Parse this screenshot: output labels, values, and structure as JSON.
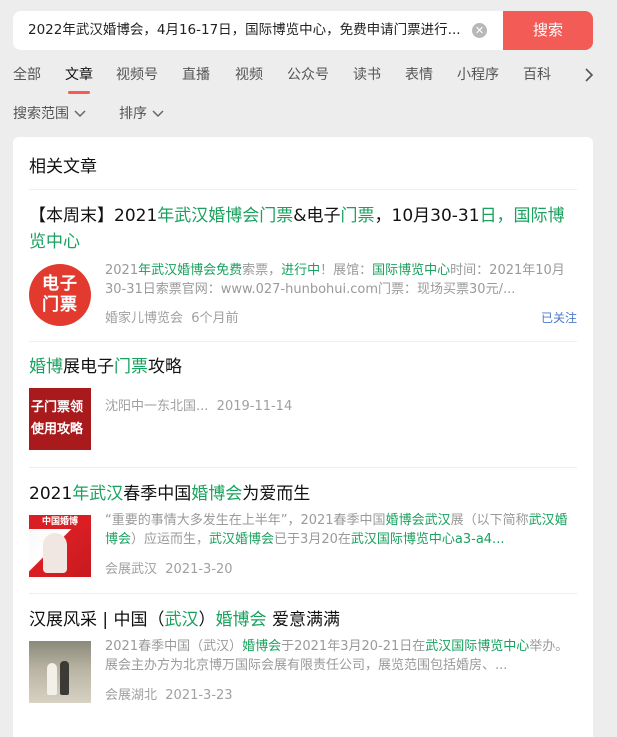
{
  "search": {
    "query": "2022年武汉婚博会，4月16-17日，国际博览中心，免费申请门票进行...",
    "button_label": "搜索"
  },
  "tabs": [
    "全部",
    "文章",
    "视频号",
    "直播",
    "视频",
    "公众号",
    "读书",
    "表情",
    "小程序",
    "百科"
  ],
  "active_tab": "文章",
  "filters": {
    "range_label": "搜索范围",
    "sort_label": "排序"
  },
  "section_title": "相关文章",
  "results": [
    {
      "title_parts": [
        "【本周末】2021",
        "年武汉婚博会门票",
        "&电子",
        "门票",
        "，10月30-31",
        "日，国际",
        "博览中心"
      ],
      "snippet_parts": [
        "2021",
        "年武汉婚博会免费",
        "索票，",
        "进行中",
        "！展馆：",
        "国际博览中心",
        "时间：2021年10月30-31日索票官网：www.027-hunbohui.com门票：现场买票30元/..."
      ],
      "thumb_text": [
        "电子",
        "门票"
      ],
      "source": "婚家儿博览会",
      "time": "6个月前",
      "followed_label": "已关注"
    },
    {
      "title_parts": [
        "婚博",
        "展电子",
        "门票",
        "攻略"
      ],
      "thumb_text": [
        "子门票领",
        "使用攻略"
      ],
      "source": "沈阳中一东北国...",
      "time": "2019-11-14"
    },
    {
      "title_parts": [
        "2021",
        "年武汉",
        "春季中国",
        "婚博会",
        "为爱而生"
      ],
      "snippet_parts": [
        "“重要的事情大多发生在上半年”，2021春季中国",
        "婚博会武汉",
        "展（以下简称",
        "武汉婚博会",
        "）应运而生，",
        "武汉婚博会",
        "已于3月20在",
        "武汉国际博览中心",
        "a3-a4..."
      ],
      "thumb_text": [
        "中国婚博"
      ],
      "source": "会展武汉",
      "time": "2021-3-20"
    },
    {
      "title_parts": [
        "汉展风采 | 中国（",
        "武汉",
        "）",
        "婚博会",
        " 爱意满满"
      ],
      "snippet_parts": [
        "2021春季中国（武汉）",
        "婚博会",
        "于2021年3月20-21日在",
        "武汉国际博览中心",
        "举办。展会主办方为北京博万国际会展有限责任公司，展览范围包括婚房、..."
      ],
      "source": "会展湖北",
      "time": "2021-3-23"
    }
  ],
  "colors": {
    "accent": "#f25b56",
    "highlight": "#19a15e",
    "link": "#4a78c9"
  }
}
